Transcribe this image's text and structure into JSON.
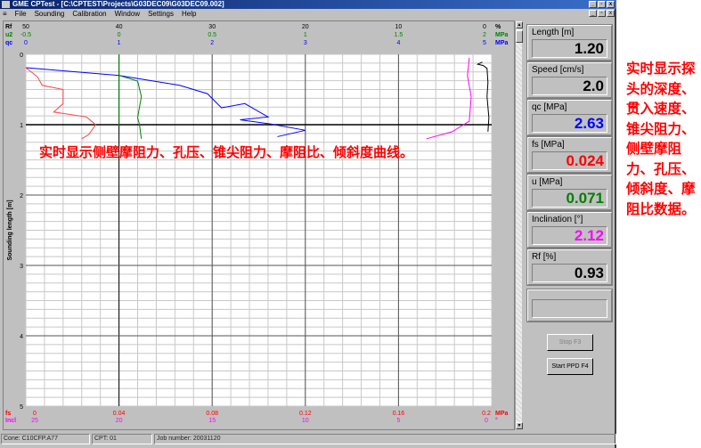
{
  "window": {
    "title": "GME CPTest - [C:\\CPTEST\\Projects\\G03DEC09\\G03DEC09.002]",
    "controls": [
      "_",
      "▫",
      "x"
    ]
  },
  "menu": [
    "File",
    "Sounding",
    "Calibration",
    "Window",
    "Settings",
    "Help"
  ],
  "axes_top": {
    "rf": {
      "name": "Rf",
      "unit": "%",
      "ticks": [
        "50",
        "40",
        "30",
        "20",
        "10",
        "0"
      ],
      "color": "#000000"
    },
    "u2": {
      "name": "u2",
      "unit": "MPa",
      "ticks": [
        "-0.5",
        "0",
        "0.5",
        "1",
        "1.5",
        "2"
      ],
      "color": "#008000"
    },
    "qc": {
      "name": "qc",
      "unit": "MPa",
      "ticks": [
        "0",
        "1",
        "2",
        "3",
        "4",
        "5"
      ],
      "color": "#0000ff"
    }
  },
  "axes_bottom": {
    "fs": {
      "name": "fs",
      "unit": "MPa",
      "ticks": [
        "0",
        "0.04",
        "0.08",
        "0.12",
        "0.16",
        "0.2"
      ],
      "color": "#ff0000"
    },
    "incl": {
      "name": "Incl",
      "unit": "°",
      "ticks": [
        "25",
        "20",
        "15",
        "10",
        "5",
        "0"
      ],
      "color": "#ff00ff"
    }
  },
  "depth_axis": {
    "label": "Sounding length [m]",
    "ticks": [
      "0",
      "1",
      "2",
      "3",
      "4",
      "5"
    ]
  },
  "curves": {
    "qc": [
      [
        0,
        0.19
      ],
      [
        1,
        0.3
      ],
      [
        1.65,
        0.44
      ],
      [
        1.95,
        0.56
      ],
      [
        2.1,
        0.76
      ],
      [
        2.35,
        0.7
      ],
      [
        2.6,
        0.89
      ],
      [
        2.3,
        0.93
      ],
      [
        2.63,
        0.99
      ],
      [
        3.0,
        1.08
      ],
      [
        2.7,
        1.17
      ]
    ],
    "fs": [
      [
        0,
        0.19
      ],
      [
        0.005,
        0.32
      ],
      [
        0.007,
        0.44
      ],
      [
        0.016,
        0.5
      ],
      [
        0.016,
        0.7
      ],
      [
        0.012,
        0.82
      ],
      [
        0.026,
        0.89
      ],
      [
        0.03,
        1.0
      ],
      [
        0.027,
        1.14
      ],
      [
        0.024,
        1.2
      ]
    ],
    "u2": [
      [
        0,
        0.3
      ],
      [
        0.1,
        0.38
      ],
      [
        0.12,
        0.6
      ],
      [
        0.1,
        0.9
      ],
      [
        0.11,
        1.0
      ],
      [
        0.12,
        1.2
      ]
    ],
    "rf": [
      [
        1.0,
        0.11
      ],
      [
        1.5,
        0.14
      ],
      [
        0.9,
        0.16
      ],
      [
        0.5,
        0.2
      ],
      [
        0.4,
        0.4
      ],
      [
        0.5,
        0.6
      ],
      [
        0.3,
        0.9
      ],
      [
        0.4,
        1.1
      ]
    ],
    "incl": [
      [
        1.2,
        0.05
      ],
      [
        1.3,
        0.3
      ],
      [
        1.1,
        0.6
      ],
      [
        1.2,
        0.95
      ],
      [
        2.12,
        1.1
      ],
      [
        3.5,
        1.2
      ]
    ]
  },
  "panels": [
    {
      "label": "Length [m]",
      "value": "1.20",
      "color": "#000000"
    },
    {
      "label": "Speed [cm/s]",
      "value": "2.0",
      "color": "#000000"
    },
    {
      "label": "qc  [MPa]",
      "value": "2.63",
      "color": "#0000ff"
    },
    {
      "label": "fs  [MPa]",
      "value": "0.024",
      "color": "#ff0000"
    },
    {
      "label": "u  [MPa]",
      "value": "0.071",
      "color": "#008000"
    },
    {
      "label": "Inclination [°]",
      "value": "2.12",
      "color": "#ff00ff"
    },
    {
      "label": "Rf [%]",
      "value": "0.93",
      "color": "#000000"
    }
  ],
  "buttons": {
    "stop": "Stop F3",
    "start_ppd": "Start PPD F4"
  },
  "status": {
    "cone": "Cone: C10CFP.A77",
    "cpt": "CPT: 01",
    "job": "Job number: 20031120"
  },
  "annotations": {
    "left": "实时显示侧壁摩阻力、孔压、锥尖阻力、摩阻比、倾斜度曲线。",
    "right": "实时显示探头的深度、贯入速度、锥尖阻力、侧壁摩阻力、孔压、倾斜度、摩阻比数据。"
  }
}
